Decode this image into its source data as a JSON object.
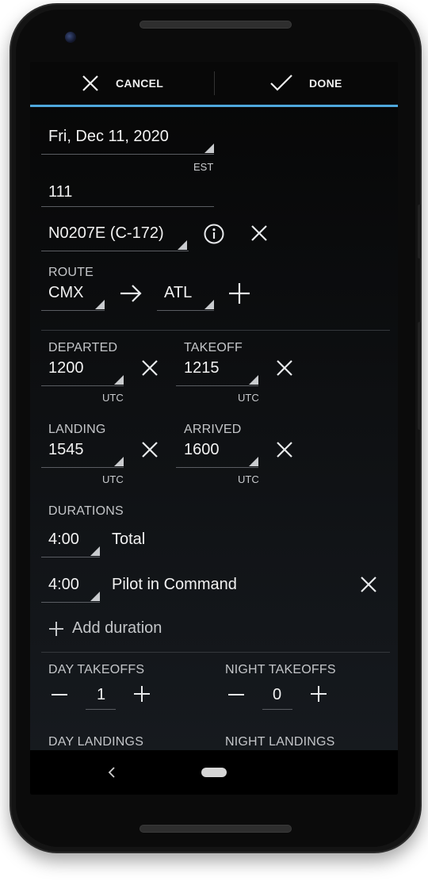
{
  "toolbar": {
    "cancel_label": "CANCEL",
    "done_label": "DONE"
  },
  "flight": {
    "date": "Fri, Dec 11, 2020",
    "timezone": "EST",
    "flight_number": "111",
    "aircraft": "N0207E (C-172)"
  },
  "route": {
    "label": "ROUTE",
    "from": "CMX",
    "to": "ATL"
  },
  "times": {
    "departed": {
      "label": "DEPARTED",
      "value": "1200",
      "tz": "UTC"
    },
    "takeoff": {
      "label": "TAKEOFF",
      "value": "1215",
      "tz": "UTC"
    },
    "landing": {
      "label": "LANDING",
      "value": "1545",
      "tz": "UTC"
    },
    "arrived": {
      "label": "ARRIVED",
      "value": "1600",
      "tz": "UTC"
    }
  },
  "durations": {
    "label": "DURATIONS",
    "items": [
      {
        "value": "4:00",
        "name": "Total"
      },
      {
        "value": "4:00",
        "name": "Pilot in Command"
      }
    ],
    "add_label": "Add duration"
  },
  "counts": {
    "day_takeoffs": {
      "label": "DAY TAKEOFFS",
      "value": "1"
    },
    "night_takeoffs": {
      "label": "NIGHT TAKEOFFS",
      "value": "0"
    },
    "day_landings": {
      "label": "DAY LANDINGS"
    },
    "night_landings": {
      "label": "NIGHT LANDINGS"
    }
  },
  "icons": {
    "close": "close-icon",
    "check": "check-icon",
    "info": "info-icon",
    "arrow": "arrow-right-icon",
    "plus": "plus-icon",
    "minus": "minus-icon",
    "back": "back-icon"
  }
}
